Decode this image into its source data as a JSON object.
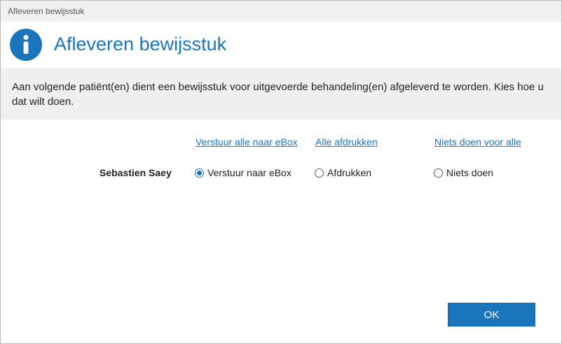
{
  "window": {
    "title": "Afleveren bewijsstuk"
  },
  "header": {
    "icon": "info-icon",
    "title": "Afleveren bewijsstuk"
  },
  "message": "Aan volgende patiënt(en) dient een bewijsstuk voor uitgevoerde behandeling(en) afgeleverd te worden. Kies hoe u dat wilt doen.",
  "columns": {
    "ebox_all": "Verstuur alle naar eBox",
    "print_all": "Alle afdrukken",
    "nothing_all": "Niets doen voor alle"
  },
  "patients": [
    {
      "name": "Sebastien Saey",
      "options": {
        "ebox": "Verstuur naar eBox",
        "print": "Afdrukken",
        "nothing": "Niets doen"
      },
      "selected": "ebox"
    }
  ],
  "buttons": {
    "ok": "OK"
  },
  "colors": {
    "accent": "#1a75bb",
    "band": "#efefef"
  }
}
